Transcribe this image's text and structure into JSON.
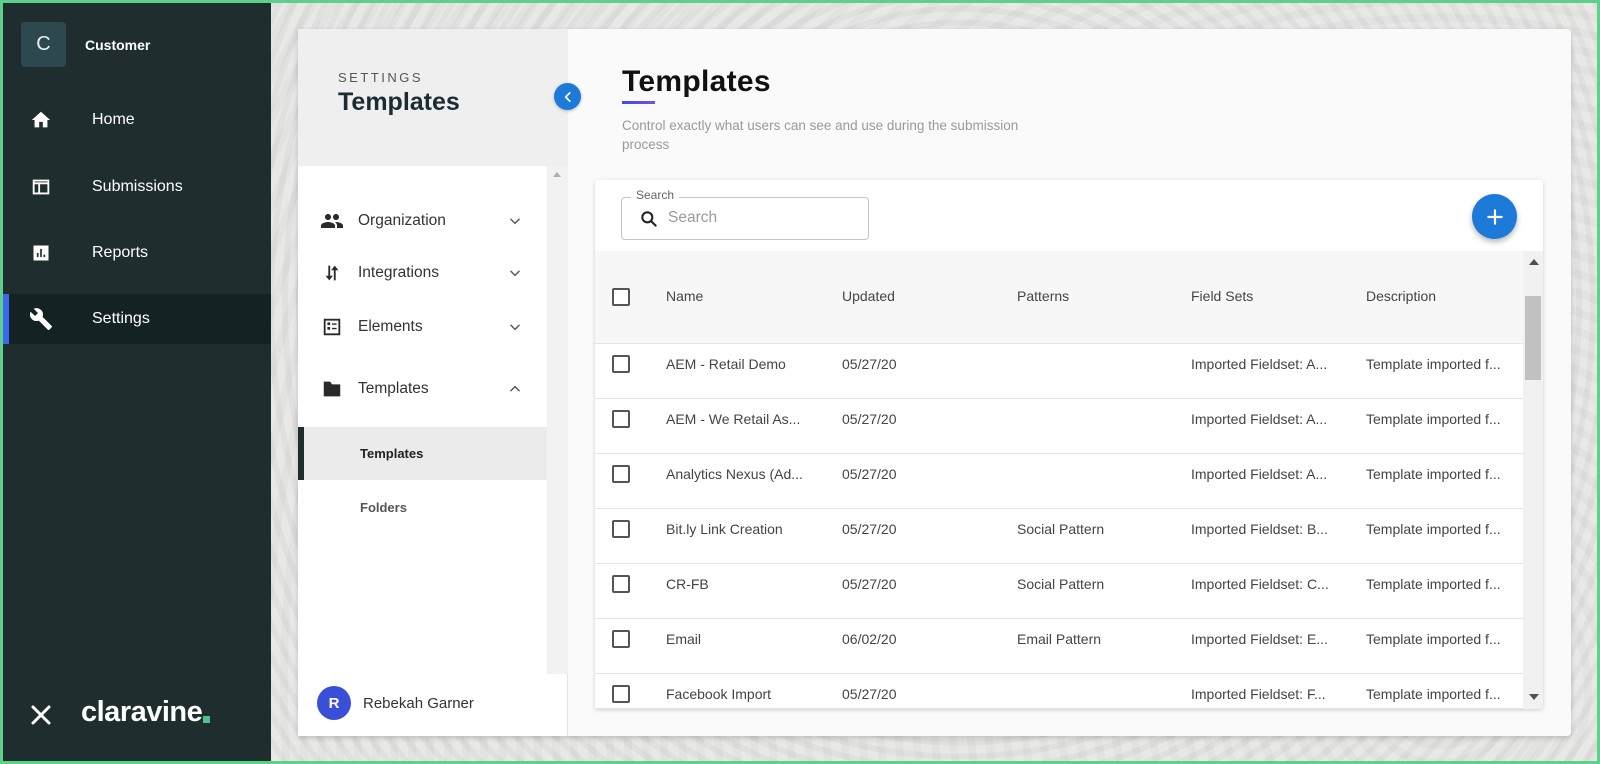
{
  "nav": {
    "account": {
      "initial": "C",
      "name": "Customer"
    },
    "items": [
      {
        "label": "Home",
        "icon": "home-icon"
      },
      {
        "label": "Submissions",
        "icon": "table-icon"
      },
      {
        "label": "Reports",
        "icon": "bar-chart-icon"
      },
      {
        "label": "Settings",
        "icon": "wrench-icon",
        "active": true
      }
    ],
    "brand": "claravine",
    "close_icon": "close-icon"
  },
  "settings_panel": {
    "eyebrow": "SETTINGS",
    "title": "Templates",
    "sections": [
      {
        "label": "Organization",
        "icon": "people-icon",
        "expanded": false
      },
      {
        "label": "Integrations",
        "icon": "swap-vertical-icon",
        "expanded": false
      },
      {
        "label": "Elements",
        "icon": "list-alt-icon",
        "expanded": false
      },
      {
        "label": "Templates",
        "icon": "folder-icon",
        "expanded": true
      }
    ],
    "children": [
      {
        "label": "Templates",
        "active": true
      },
      {
        "label": "Folders",
        "active": false
      }
    ],
    "user": {
      "initial": "R",
      "name": "Rebekah Garner"
    }
  },
  "main": {
    "title": "Templates",
    "description": "Control exactly what users can see and use during the submission process",
    "search": {
      "legend": "Search",
      "placeholder": "Search",
      "value": ""
    },
    "table": {
      "columns": [
        "Name",
        "Updated",
        "Patterns",
        "Field Sets",
        "Description"
      ],
      "rows": [
        {
          "name": "AEM - Retail Demo",
          "updated": "05/27/20",
          "patterns": "",
          "field_sets": "Imported Fieldset: A...",
          "description": "Template imported f..."
        },
        {
          "name": "AEM - We Retail As...",
          "updated": "05/27/20",
          "patterns": "",
          "field_sets": "Imported Fieldset: A...",
          "description": "Template imported f..."
        },
        {
          "name": "Analytics Nexus (Ad...",
          "updated": "05/27/20",
          "patterns": "",
          "field_sets": "Imported Fieldset: A...",
          "description": "Template imported f..."
        },
        {
          "name": "Bit.ly Link Creation",
          "updated": "05/27/20",
          "patterns": "Social Pattern",
          "field_sets": "Imported Fieldset: B...",
          "description": "Template imported f..."
        },
        {
          "name": "CR-FB",
          "updated": "05/27/20",
          "patterns": "Social Pattern",
          "field_sets": "Imported Fieldset: C...",
          "description": "Template imported f..."
        },
        {
          "name": "Email",
          "updated": "06/02/20",
          "patterns": "Email Pattern",
          "field_sets": "Imported Fieldset: E...",
          "description": "Template imported f..."
        },
        {
          "name": "Facebook Import",
          "updated": "05/27/20",
          "patterns": "",
          "field_sets": "Imported Fieldset: F...",
          "description": "Template imported f..."
        }
      ]
    }
  },
  "colors": {
    "nav_bg": "#1f2d2f",
    "accent_blue": "#1e7ad9",
    "active_indicator": "#3a66f0",
    "brand_green": "#4ac38a"
  }
}
